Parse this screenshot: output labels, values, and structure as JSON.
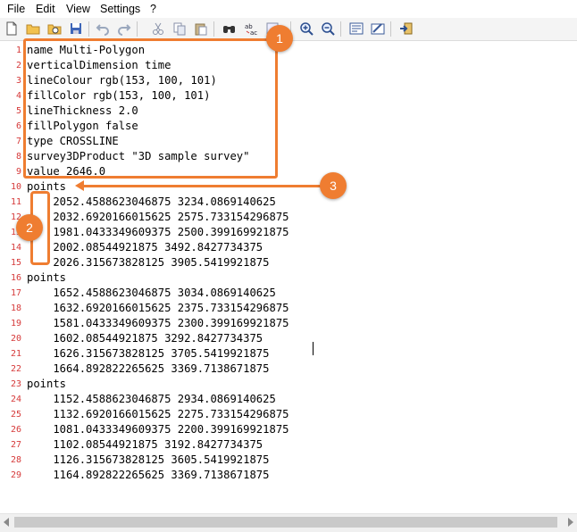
{
  "menu": {
    "items": [
      {
        "label": "File"
      },
      {
        "label": "Edit"
      },
      {
        "label": "View"
      },
      {
        "label": "Settings"
      },
      {
        "label": "?"
      }
    ]
  },
  "toolbar": {
    "icons": [
      "new-file-icon",
      "open-folder-icon",
      "open-icon",
      "save-icon",
      "undo-icon",
      "redo-icon",
      "cut-icon",
      "copy-icon",
      "paste-icon",
      "find-icon",
      "replace-icon",
      "spellcheck-icon",
      "zoom-in-icon",
      "zoom-out-icon",
      "word-wrap-icon",
      "properties-icon",
      "exit-icon"
    ]
  },
  "editor": {
    "lines": [
      {
        "n": "1",
        "text": "name Multi-Polygon"
      },
      {
        "n": "2",
        "text": "verticalDimension time"
      },
      {
        "n": "3",
        "text": "lineColour rgb(153, 100, 101)"
      },
      {
        "n": "4",
        "text": "fillColor rgb(153, 100, 101)"
      },
      {
        "n": "5",
        "text": "lineThickness 2.0"
      },
      {
        "n": "6",
        "text": "fillPolygon false"
      },
      {
        "n": "7",
        "text": "type CROSSLINE"
      },
      {
        "n": "8",
        "text": "survey3DProduct \"3D sample survey\""
      },
      {
        "n": "9",
        "text": "value 2646.0"
      },
      {
        "n": "10",
        "text": "points"
      },
      {
        "n": "11",
        "text": "    2052.4588623046875 3234.0869140625"
      },
      {
        "n": "12",
        "text": "    2032.6920166015625 2575.733154296875"
      },
      {
        "n": "13",
        "text": "    1981.0433349609375 2500.399169921875"
      },
      {
        "n": "14",
        "text": "    2002.08544921875 3492.8427734375"
      },
      {
        "n": "15",
        "text": "    2026.315673828125 3905.5419921875"
      },
      {
        "n": "16",
        "text": "points"
      },
      {
        "n": "17",
        "text": "    1652.4588623046875 3034.0869140625"
      },
      {
        "n": "18",
        "text": "    1632.6920166015625 2375.733154296875"
      },
      {
        "n": "19",
        "text": "    1581.0433349609375 2300.399169921875"
      },
      {
        "n": "20",
        "text": "    1602.08544921875 3292.8427734375"
      },
      {
        "n": "21",
        "text": "    1626.315673828125 3705.5419921875"
      },
      {
        "n": "22",
        "text": "    1664.892822265625 3369.7138671875"
      },
      {
        "n": "23",
        "text": "points"
      },
      {
        "n": "24",
        "text": "    1152.4588623046875 2934.0869140625"
      },
      {
        "n": "25",
        "text": "    1132.6920166015625 2275.733154296875"
      },
      {
        "n": "26",
        "text": "    1081.0433349609375 2200.399169921875"
      },
      {
        "n": "27",
        "text": "    1102.08544921875 3192.8427734375"
      },
      {
        "n": "28",
        "text": "    1126.315673828125 3605.5419921875"
      },
      {
        "n": "29",
        "text": "    1164.892822265625 3369.7138671875"
      }
    ]
  },
  "annotations": {
    "badge1": "1",
    "badge2": "2",
    "badge3": "3",
    "color": "#ef7d31"
  }
}
